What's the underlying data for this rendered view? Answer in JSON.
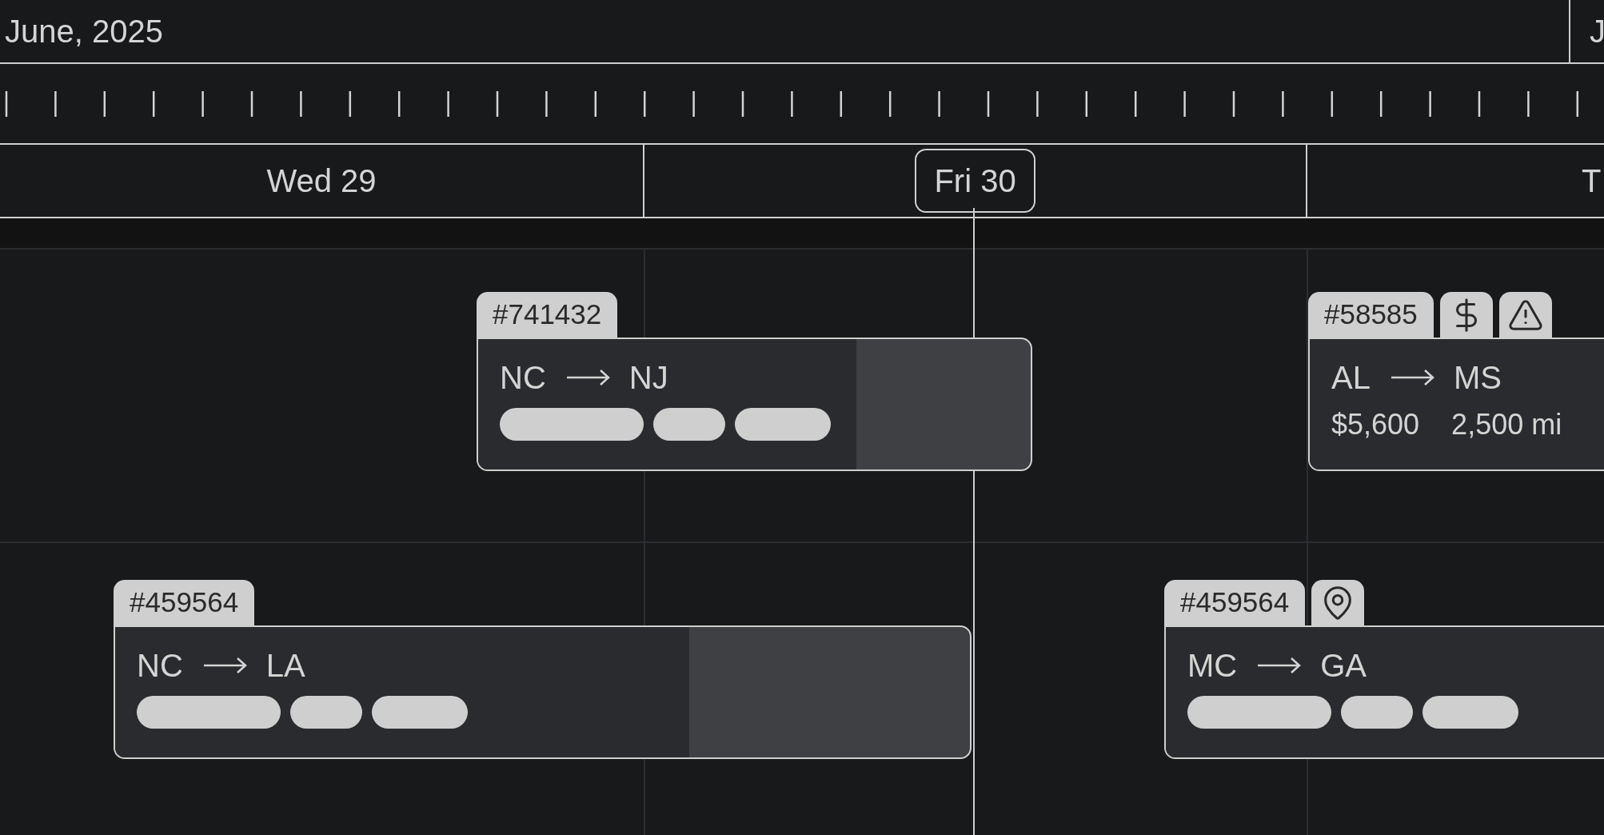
{
  "months": [
    {
      "label": "June, 2025"
    },
    {
      "label": "J"
    }
  ],
  "days": [
    {
      "label": "Wed 29",
      "current": false
    },
    {
      "label": "Fri 30",
      "current": true
    },
    {
      "label": "T",
      "current": false
    }
  ],
  "cards": [
    {
      "id": "#741432",
      "origin": "NC",
      "destination": "NJ",
      "details": {
        "kind": "placeholders"
      }
    },
    {
      "id": "#58585",
      "badges": [
        {
          "kind": "dollar"
        },
        {
          "kind": "warning"
        }
      ],
      "origin": "AL",
      "destination": "MS",
      "details": {
        "kind": "stats",
        "values": [
          "$5,600",
          "2,500 mi"
        ]
      }
    },
    {
      "id": "#459564",
      "origin": "NC",
      "destination": "LA",
      "details": {
        "kind": "placeholders"
      }
    },
    {
      "id": "#459564",
      "badges": [
        {
          "kind": "pin"
        }
      ],
      "origin": "MC",
      "destination": "GA",
      "details": {
        "kind": "placeholders"
      }
    }
  ]
}
